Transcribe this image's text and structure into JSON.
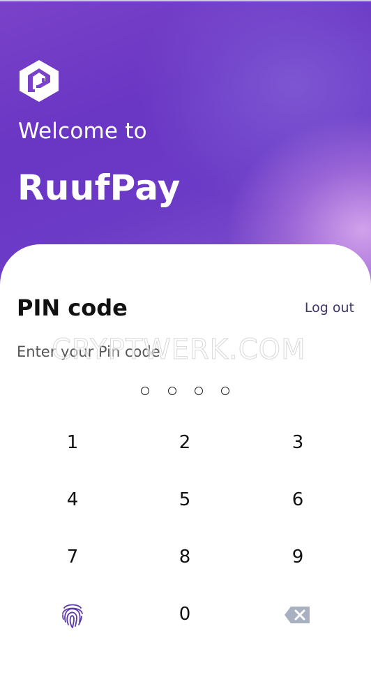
{
  "header": {
    "welcome_text": "Welcome to",
    "brand_name": "RuufPay",
    "logo_icon": "ruufpay-logo-icon"
  },
  "pin_panel": {
    "title": "PIN code",
    "logout_label": "Log out",
    "instruction": "Enter your Pin code",
    "pin_length": 4,
    "entered_digits": 0
  },
  "watermark": "CRYPTWERK.COM",
  "keypad": {
    "keys": [
      "1",
      "2",
      "3",
      "4",
      "5",
      "6",
      "7",
      "8",
      "9",
      "0"
    ],
    "fingerprint_icon": "fingerprint-icon",
    "backspace_icon": "backspace-icon"
  },
  "colors": {
    "brand_purple": "#6a36c4",
    "fingerprint": "#5b3aa6",
    "backspace": "#a9b0c2"
  }
}
